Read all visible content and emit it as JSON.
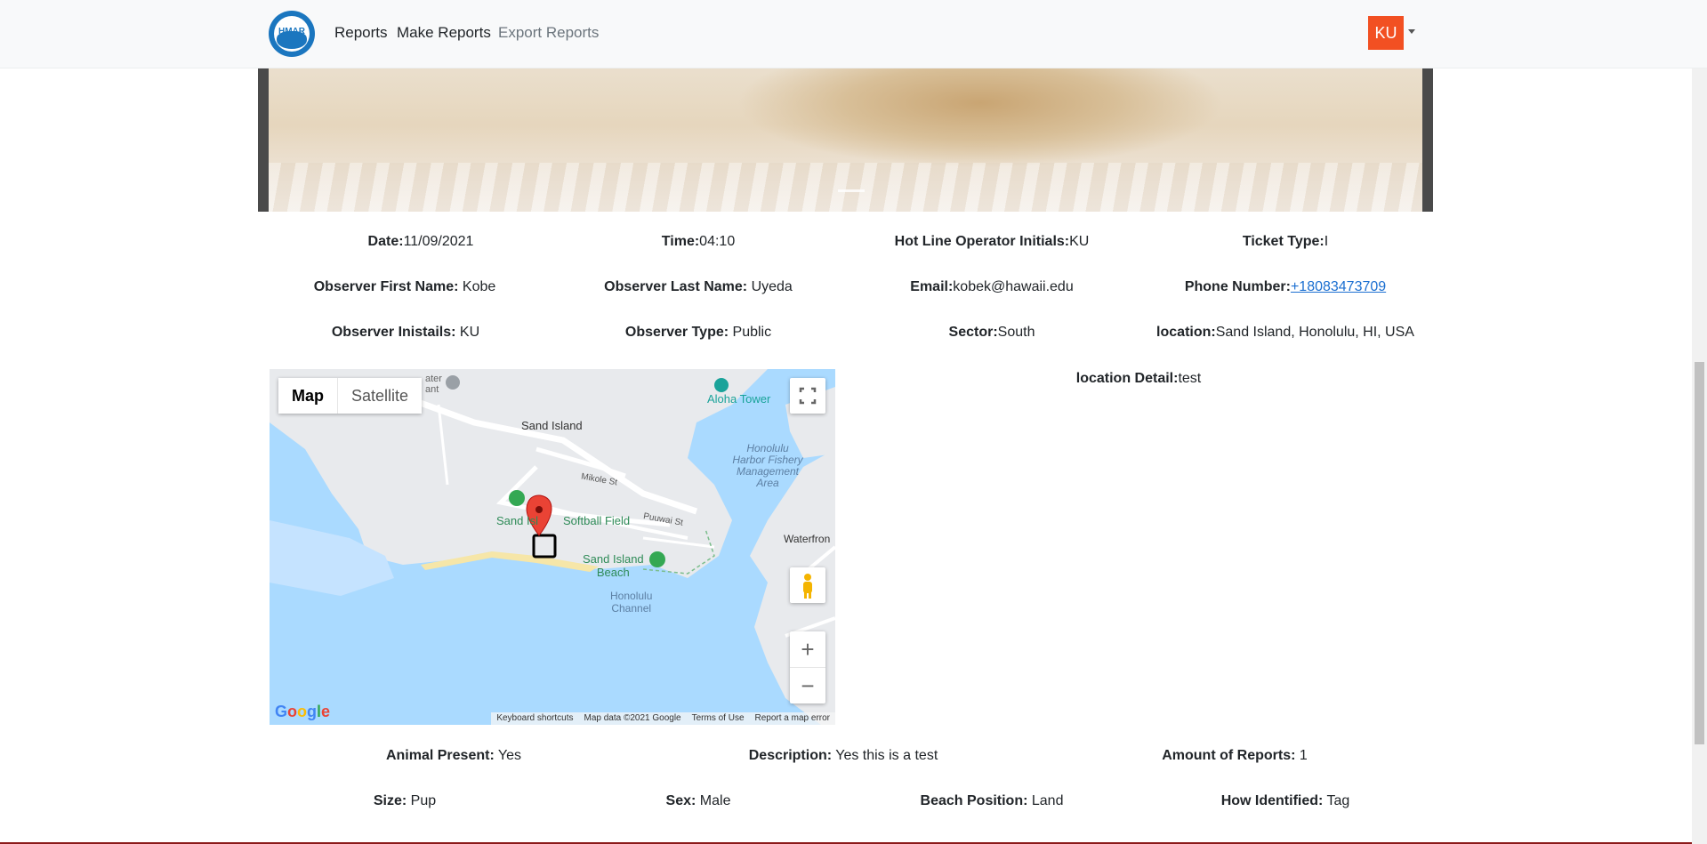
{
  "navbar": {
    "logo_text": "HMAR",
    "links": [
      "Reports",
      "Make Reports",
      "Export Reports"
    ],
    "user_initials": "KU"
  },
  "report": {
    "row1": [
      {
        "label": "Date:",
        "value": "11/09/2021"
      },
      {
        "label": "Time:",
        "value": "04:10"
      },
      {
        "label": "Hot Line Operator Initials:",
        "value": "KU"
      },
      {
        "label": "Ticket Type:",
        "value": "I"
      }
    ],
    "row2": [
      {
        "label": "Observer First Name:",
        "value": " Kobe"
      },
      {
        "label": "Observer Last Name:",
        "value": " Uyeda"
      },
      {
        "label": "Email:",
        "value": "kobek@hawaii.edu"
      },
      {
        "label": "Phone Number:",
        "value": "+18083473709"
      }
    ],
    "row3": [
      {
        "label": "Observer Inistails:",
        "value": " KU"
      },
      {
        "label": "Observer Type:",
        "value": " Public"
      },
      {
        "label": "Sector:",
        "value": "South"
      },
      {
        "label": "location:",
        "value": "Sand Island, Honolulu, HI, USA"
      }
    ],
    "location_detail": {
      "label": "location Detail:",
      "value": "test"
    },
    "row4": [
      {
        "label": "Animal Present:",
        "value": " Yes"
      },
      {
        "label": "Description:",
        "value": " Yes this is a test"
      },
      {
        "label": "Amount of Reports:",
        "value": " 1"
      }
    ],
    "row5": [
      {
        "label": "Size:",
        "value": " Pup"
      },
      {
        "label": "Sex:",
        "value": " Male"
      },
      {
        "label": "Beach Position:",
        "value": " Land"
      },
      {
        "label": "How Identified:",
        "value": " Tag"
      }
    ]
  },
  "map": {
    "type_map": "Map",
    "type_satellite": "Satellite",
    "labels": {
      "sand_island": "Sand Island",
      "aloha_tower": "Aloha Tower",
      "fishery": [
        "Honolulu",
        "Harbor Fishery",
        "Management",
        "Area"
      ],
      "mikole": "Mikole St",
      "puuwai": "Puuwai St",
      "softball": "Softball Field",
      "sand_isl": "Sand Isl",
      "sand_island_beach": [
        "Sand Island",
        "Beach"
      ],
      "channel": [
        "Honolulu",
        "Channel"
      ],
      "waterfront": "Waterfron",
      "water_treatment": [
        "ater",
        "ant"
      ]
    },
    "footer": [
      "Keyboard shortcuts",
      "Map data ©2021 Google",
      "Terms of Use",
      "Report a map error"
    ],
    "google_logo": "Google",
    "zoom_in": "+",
    "zoom_out": "−"
  },
  "colors": {
    "accent": "#f25022",
    "link": "#1b6fd1",
    "water": "#aadaff",
    "land": "#e8eaed",
    "marker": "#ea4335"
  }
}
